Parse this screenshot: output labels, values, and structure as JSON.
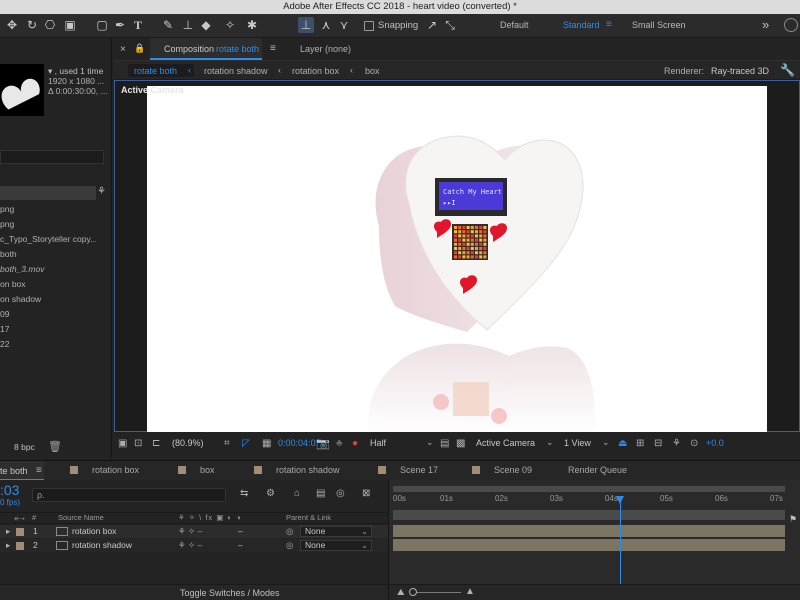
{
  "window_title": "Adobe After Effects CC 2018 - heart video (converted) *",
  "toolbar": {
    "snapping_label": "Snapping",
    "workspaces": [
      "Default",
      "Standard",
      "Small Screen"
    ],
    "more": "»"
  },
  "project": {
    "info_used": "▾ , used 1 time",
    "info_size": "1920 x 1080 ...",
    "info_duration": "Δ 0:00:30:00, ...",
    "items": [
      "png",
      "png",
      "c_Typo_Storyteller copy...",
      "both",
      "both_3.mov",
      "on box",
      "on shadow",
      "09",
      "17",
      "22"
    ],
    "bpc": "8 bpc"
  },
  "comp": {
    "tab_prefix": "Composition",
    "tab_name": "rotate both",
    "layer_tab": "Layer (none)",
    "breadcrumbs": [
      "rotate both",
      "rotation shadow",
      "rotation box",
      "box"
    ],
    "renderer_label": "Renderer:",
    "renderer_value": "Ray-traced 3D",
    "active_camera_label": "Active Camera",
    "lcd_line1": "Catch My Heart",
    "lcd_line2": "▸▸I"
  },
  "viewer_bar": {
    "zoom": "(80.9%)",
    "timecode": "0:00:04:03",
    "resolution": "Half",
    "view": "Active Camera",
    "views": "1 View",
    "exposure": "+0.0"
  },
  "timeline": {
    "tabs": [
      {
        "label": "te both",
        "active": true
      },
      {
        "label": "rotation box"
      },
      {
        "label": "box"
      },
      {
        "label": "rotation shadow"
      },
      {
        "label": "Scene 17"
      },
      {
        "label": "Scene 09"
      },
      {
        "label": "Render Queue"
      }
    ],
    "timecode": ":03",
    "fps": "0 fps)",
    "search_placeholder": "ρ.",
    "headers": {
      "number": "#",
      "source": "Source Name",
      "parent": "Parent & Link"
    },
    "layers": [
      {
        "number": "1",
        "name": "rotation box",
        "parent": "None"
      },
      {
        "number": "2",
        "name": "rotation shadow",
        "parent": "None"
      }
    ],
    "ruler": [
      "00s",
      "01s",
      "02s",
      "03s",
      "04s",
      "05s",
      "06s",
      "07s"
    ],
    "playhead_s": 4.13,
    "toggle_label": "Toggle Switches / Modes"
  },
  "colors": {
    "accent": "#2d8ceb",
    "label_swatch": "#a08d74",
    "layer_bar": "#7d7564"
  }
}
